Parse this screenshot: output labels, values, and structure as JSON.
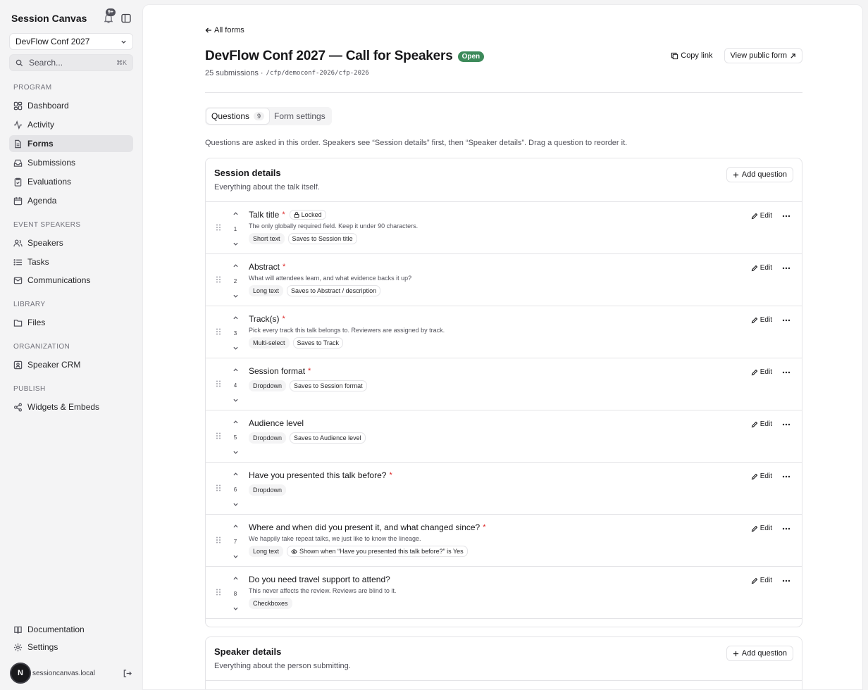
{
  "app": {
    "name": "Session Canvas",
    "notif_count": "9+"
  },
  "workspace": {
    "selected": "DevFlow Conf 2027"
  },
  "search": {
    "placeholder": "Search...",
    "shortcut": "⌘K"
  },
  "nav": {
    "program_label": "PROGRAM",
    "program": [
      "Dashboard",
      "Activity",
      "Forms",
      "Submissions",
      "Evaluations",
      "Agenda"
    ],
    "speakers_label": "EVENT SPEAKERS",
    "speakers": [
      "Speakers",
      "Tasks",
      "Communications"
    ],
    "library_label": "LIBRARY",
    "library": [
      "Files"
    ],
    "org_label": "ORGANIZATION",
    "org": [
      "Speaker CRM"
    ],
    "publish_label": "PUBLISH",
    "publish": [
      "Widgets & Embeds"
    ],
    "footer": [
      "Documentation",
      "Settings"
    ]
  },
  "user": {
    "initial": "N",
    "email": "sessioncanvas.local"
  },
  "page": {
    "back": "All forms",
    "title": "DevFlow Conf 2027 — Call for Speakers",
    "status": "Open",
    "submissions": "25 submissions ·",
    "path": "/cfp/democonf-2026/cfp-2026",
    "copy_link": "Copy link",
    "view_public": "View public form",
    "tab_questions": "Questions",
    "tab_questions_count": "9",
    "tab_settings": "Form settings",
    "hint": "Questions are asked in this order. Speakers see “Session details” first, then “Speaker details”. Drag a question to reorder it."
  },
  "session_section": {
    "title": "Session details",
    "desc": "Everything about the talk itself.",
    "add": "Add question",
    "questions": [
      {
        "num": "1",
        "title": "Talk title",
        "required": "*",
        "locked": "Locked",
        "desc": "The only globally required field. Keep it under 90 characters.",
        "type": "Short text",
        "saves": "Saves to Session title"
      },
      {
        "num": "2",
        "title": "Abstract",
        "required": "*",
        "desc": "What will attendees learn, and what evidence backs it up?",
        "type": "Long text",
        "saves": "Saves to Abstract / description"
      },
      {
        "num": "3",
        "title": "Track(s)",
        "required": "*",
        "desc": "Pick every track this talk belongs to. Reviewers are assigned by track.",
        "type": "Multi-select",
        "saves": "Saves to Track"
      },
      {
        "num": "4",
        "title": "Session format",
        "required": "*",
        "desc": "",
        "type": "Dropdown",
        "saves": "Saves to Session format"
      },
      {
        "num": "5",
        "title": "Audience level",
        "required": "",
        "desc": "",
        "type": "Dropdown",
        "saves": "Saves to Audience level"
      },
      {
        "num": "6",
        "title": "Have you presented this talk before?",
        "required": "*",
        "desc": "",
        "type": "Dropdown",
        "saves": ""
      },
      {
        "num": "7",
        "title": "Where and when did you present it, and what changed since?",
        "required": "*",
        "desc": "We happily take repeat talks, we just like to know the lineage.",
        "type": "Long text",
        "condition": "Shown when “Have you presented this talk before?” is Yes"
      },
      {
        "num": "8",
        "title": "Do you need travel support to attend?",
        "required": "",
        "desc": "This never affects the review. Reviews are blind to it.",
        "type": "Checkboxes",
        "saves": ""
      }
    ],
    "edit": "Edit"
  },
  "speaker_section": {
    "title": "Speaker details",
    "desc": "Everything about the person submitting.",
    "add": "Add question"
  },
  "colors": {
    "accent": "#3d8a5a",
    "required": "#dc2626",
    "sidebar_bg": "#f4f4f5"
  }
}
